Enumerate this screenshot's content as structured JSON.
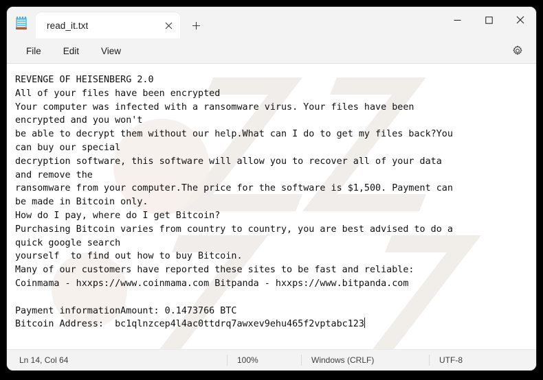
{
  "window": {
    "app_icon": "notepad-icon",
    "controls": {
      "minimize": "—",
      "maximize": "☐",
      "close": "✕"
    }
  },
  "tabs": {
    "active_tab_title": "read_it.txt",
    "close_label": "✕",
    "new_tab_label": "+"
  },
  "menubar": {
    "items": [
      {
        "label": "File"
      },
      {
        "label": "Edit"
      },
      {
        "label": "View"
      }
    ],
    "settings_icon": "gear-icon"
  },
  "editor": {
    "content": "REVENGE OF HEISENBERG 2.0\nAll of your files have been encrypted\nYour computer was infected with a ransomware virus. Your files have been\nencrypted and you won't\nbe able to decrypt them without our help.What can I do to get my files back?You\ncan buy our special\ndecryption software, this software will allow you to recover all of your data\nand remove the\nransomware from your computer.The price for the software is $1,500. Payment can\nbe made in Bitcoin only.\nHow do I pay, where do I get Bitcoin?\nPurchasing Bitcoin varies from country to country, you are best advised to do a\nquick google search\nyourself  to find out how to buy Bitcoin.\nMany of our customers have reported these sites to be fast and reliable:\nCoinmama - hxxps://www.coinmama.com Bitpanda - hxxps://www.bitpanda.com\n\nPayment informationAmount: 0.1473766 BTC\nBitcoin Address:  bc1qlnzcep4l4ac0ttdrq7awxev9ehu465f2vptabc123"
  },
  "statusbar": {
    "position": "Ln 14, Col 64",
    "zoom": "100%",
    "line_ending": "Windows (CRLF)",
    "encoding": "UTF-8"
  },
  "colors": {
    "window_chrome": "#f3f3f3",
    "editor_background": "#ffffff",
    "text": "#101010",
    "desktop": "#000000"
  }
}
